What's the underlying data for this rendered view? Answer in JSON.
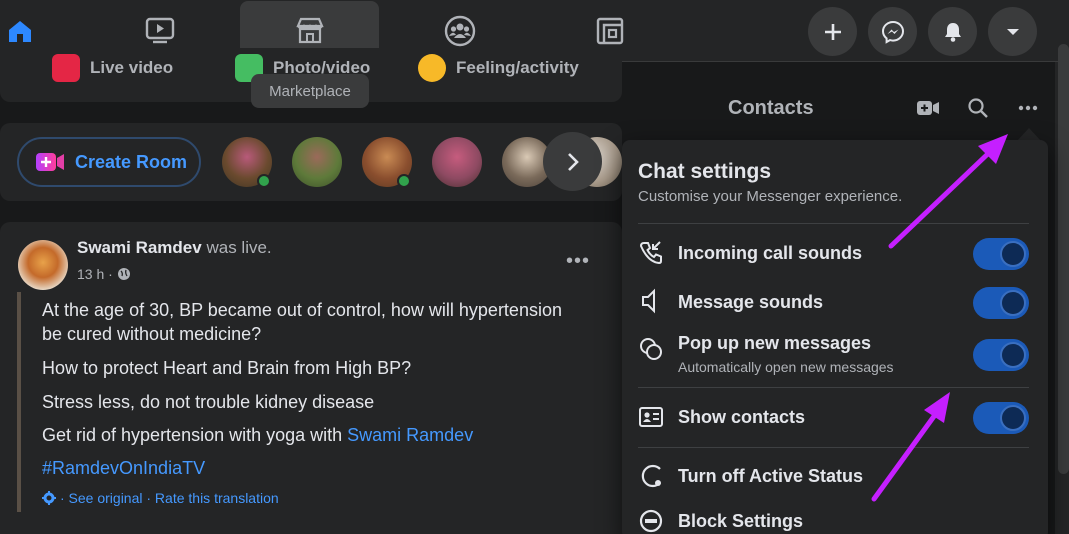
{
  "nav": {
    "tooltip": "Marketplace",
    "tabs": [
      "home-icon",
      "watch-icon",
      "marketplace-icon",
      "groups-icon",
      "gaming-icon"
    ],
    "right_buttons": [
      "plus-icon",
      "messenger-icon",
      "bell-icon",
      "caret-down-icon"
    ]
  },
  "composer": {
    "live_video": "Live video",
    "photo_video": "Photo/video",
    "feeling": "Feeling/activity"
  },
  "rooms": {
    "create_room": "Create Room"
  },
  "post": {
    "author": "Swami Ramdev",
    "action": " was live.",
    "time": "13 h ·",
    "line1a": "At the age of 30, BP became out of control, how will hypertension",
    "line1b": "be cured without medicine?",
    "line2": "How to protect Heart and Brain from High BP?",
    "line3": "Stress less, do not trouble kidney disease",
    "line4": "Get rid of hypertension with yoga with ",
    "line4_link": "Swami Ramdev",
    "hashtag": "#RamdevOnIndiaTV",
    "translation": "· See original · Rate this translation",
    "more": "•••"
  },
  "contacts": {
    "title": "Contacts"
  },
  "chat_settings": {
    "title": "Chat settings",
    "subtitle": "Customise your Messenger experience.",
    "incoming_call": "Incoming call sounds",
    "message_sounds": "Message sounds",
    "popup": "Pop up new messages",
    "popup_sub": "Automatically open new messages",
    "show_contacts": "Show contacts",
    "active_status": "Turn off Active Status",
    "block": "Block Settings"
  },
  "colors": {
    "accent": "#2d88ff",
    "link": "#4599ff",
    "toggle_on": "#1b5ab8",
    "annotation_arrow": "#c51fff"
  }
}
